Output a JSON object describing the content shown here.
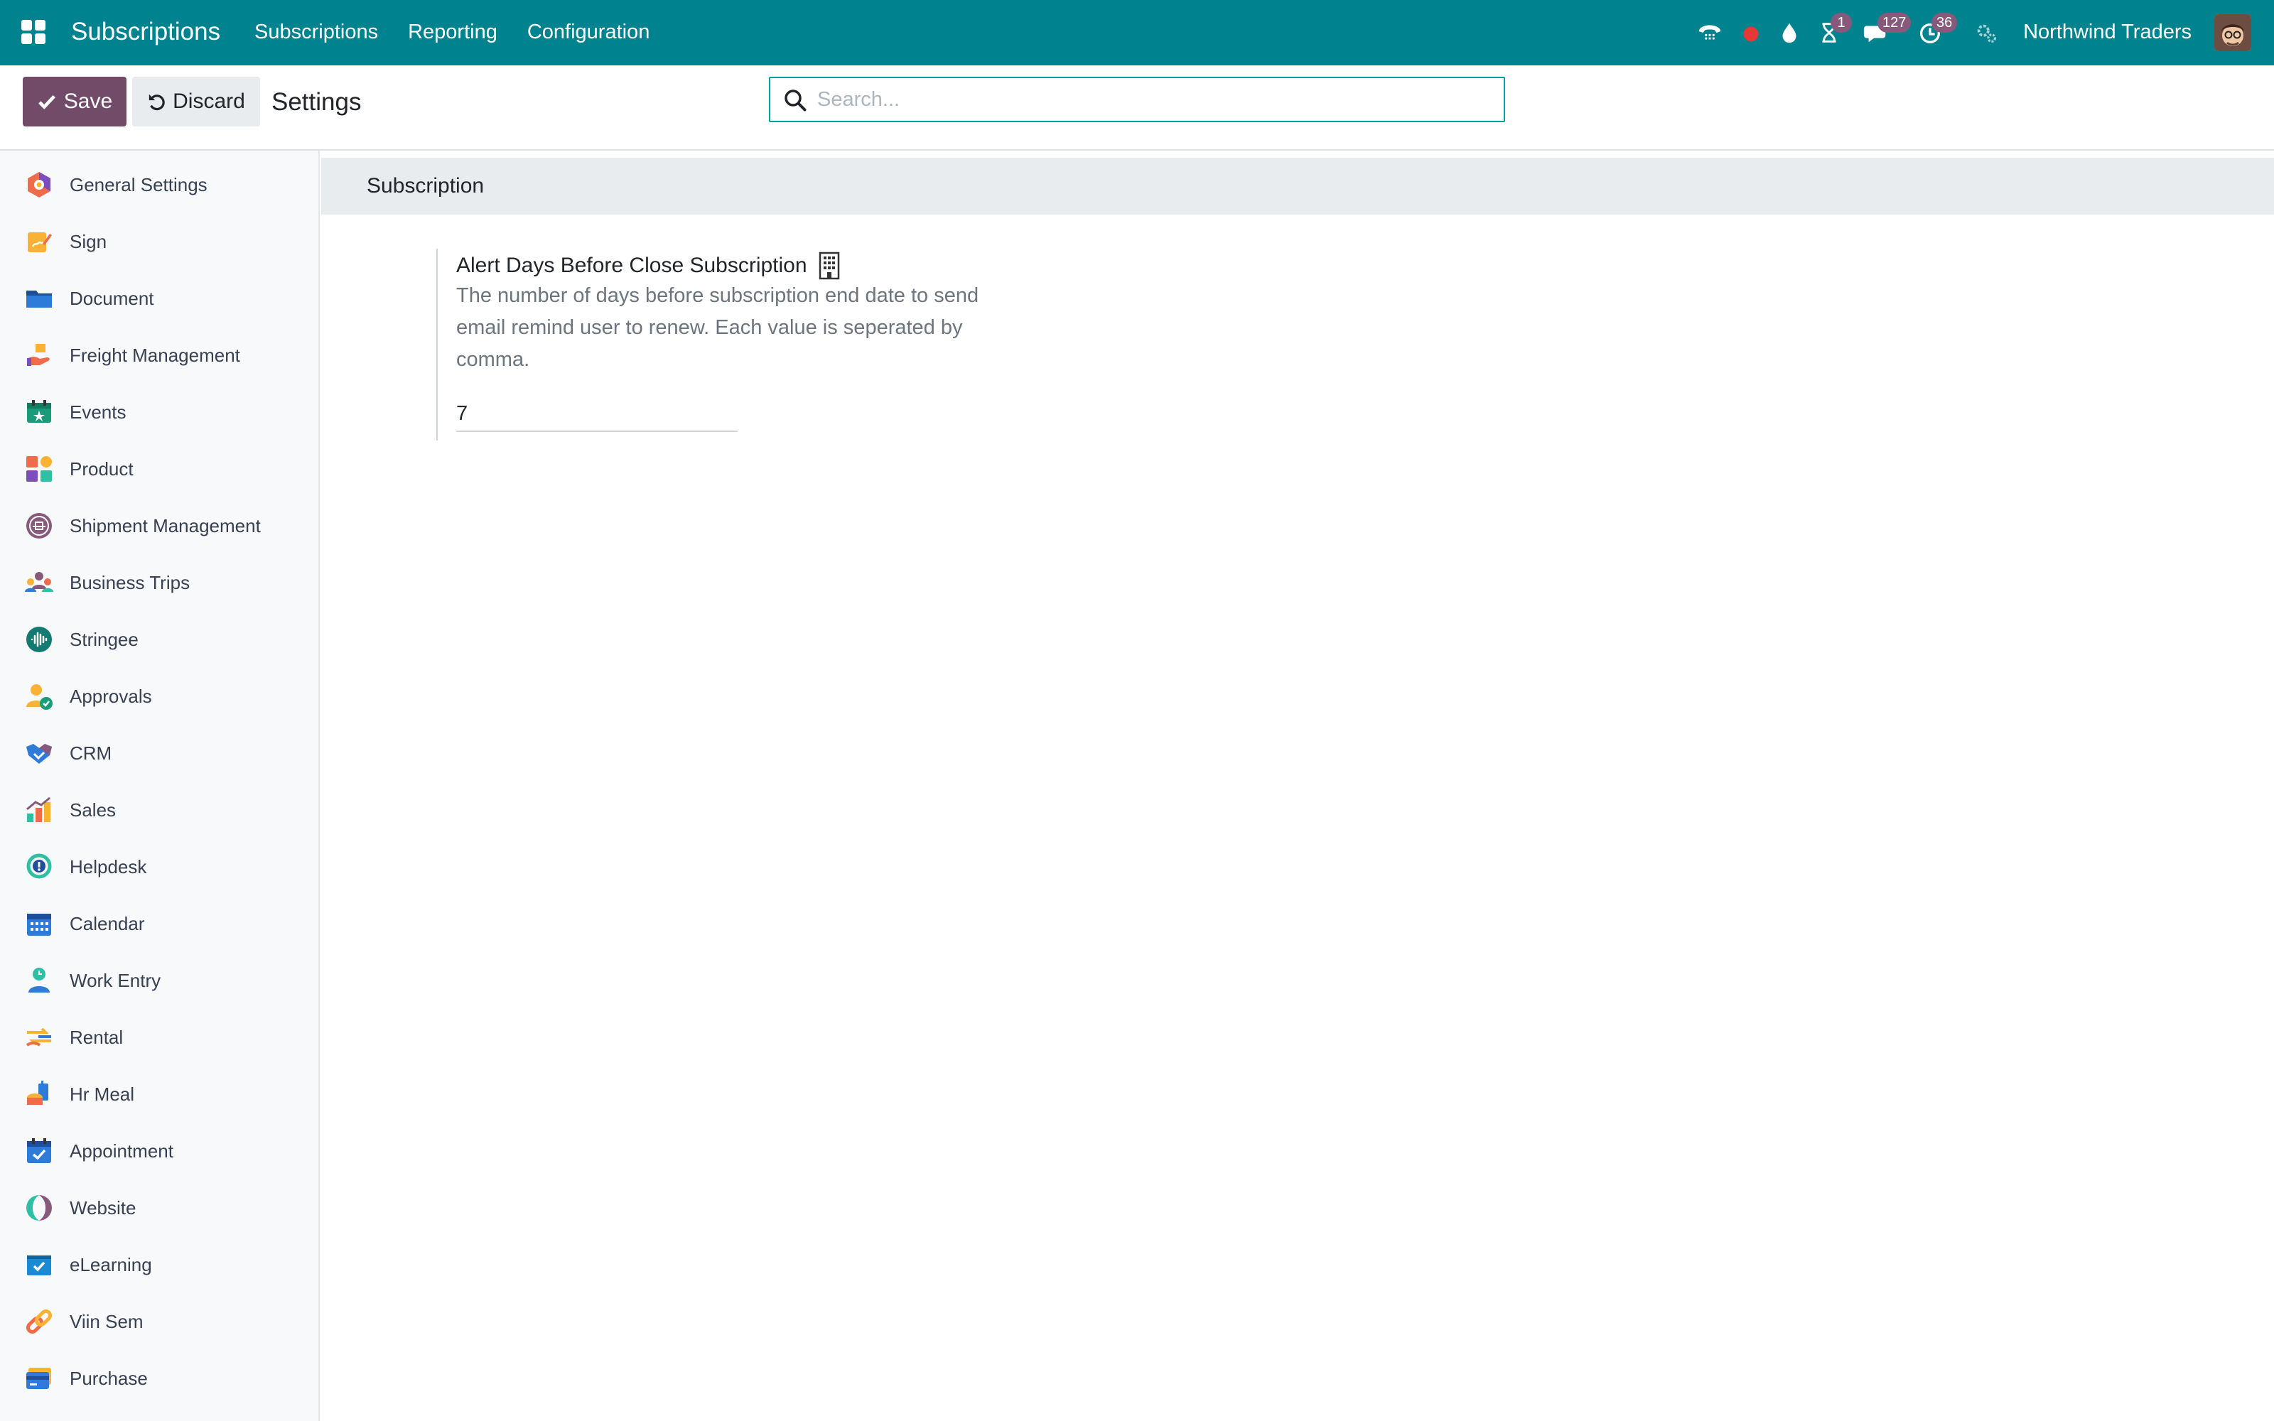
{
  "navbar": {
    "app_name": "Subscriptions",
    "menu": [
      "Subscriptions",
      "Reporting",
      "Configuration"
    ],
    "systray": [
      {
        "icon": "phone-icon",
        "badge": ""
      },
      {
        "icon": "record-dot-icon",
        "badge": ""
      },
      {
        "icon": "drop-icon",
        "badge": ""
      },
      {
        "icon": "hourglass-icon",
        "badge": "1"
      },
      {
        "icon": "chat-icon",
        "badge": "127"
      },
      {
        "icon": "clock-icon",
        "badge": "36"
      },
      {
        "icon": "gears-icon",
        "badge": ""
      }
    ],
    "company": "Northwind Traders"
  },
  "control_panel": {
    "save_label": "Save",
    "discard_label": "Discard",
    "title": "Settings",
    "search_placeholder": "Search..."
  },
  "sidebar": {
    "items": [
      {
        "label": "General Settings",
        "icon": "general-settings-icon"
      },
      {
        "label": "Sign",
        "icon": "sign-icon"
      },
      {
        "label": "Document",
        "icon": "folder-icon"
      },
      {
        "label": "Freight Management",
        "icon": "freight-icon"
      },
      {
        "label": "Events",
        "icon": "events-icon"
      },
      {
        "label": "Product",
        "icon": "product-icon"
      },
      {
        "label": "Shipment Management",
        "icon": "shipment-icon"
      },
      {
        "label": "Business Trips",
        "icon": "business-trips-icon"
      },
      {
        "label": "Stringee",
        "icon": "stringee-icon"
      },
      {
        "label": "Approvals",
        "icon": "approvals-icon"
      },
      {
        "label": "CRM",
        "icon": "crm-icon"
      },
      {
        "label": "Sales",
        "icon": "sales-icon"
      },
      {
        "label": "Helpdesk",
        "icon": "helpdesk-icon"
      },
      {
        "label": "Calendar",
        "icon": "calendar-icon"
      },
      {
        "label": "Work Entry",
        "icon": "work-entry-icon"
      },
      {
        "label": "Rental",
        "icon": "rental-icon"
      },
      {
        "label": "Hr Meal",
        "icon": "hr-meal-icon"
      },
      {
        "label": "Appointment",
        "icon": "appointment-icon"
      },
      {
        "label": "Website",
        "icon": "website-icon"
      },
      {
        "label": "eLearning",
        "icon": "elearning-icon"
      },
      {
        "label": "Viin Sem",
        "icon": "viin-sem-icon"
      },
      {
        "label": "Purchase",
        "icon": "purchase-icon"
      }
    ]
  },
  "main": {
    "section_title": "Subscription",
    "setting": {
      "label": "Alert Days Before Close Subscription",
      "description": "The number of days before subscription end date to send email remind user to renew. Each value is seperated by comma.",
      "value": "7"
    }
  },
  "colors": {
    "navbar": "#00838f",
    "primary_button": "#714b67",
    "badge": "#875a7b",
    "search_border": "#00a09d"
  }
}
